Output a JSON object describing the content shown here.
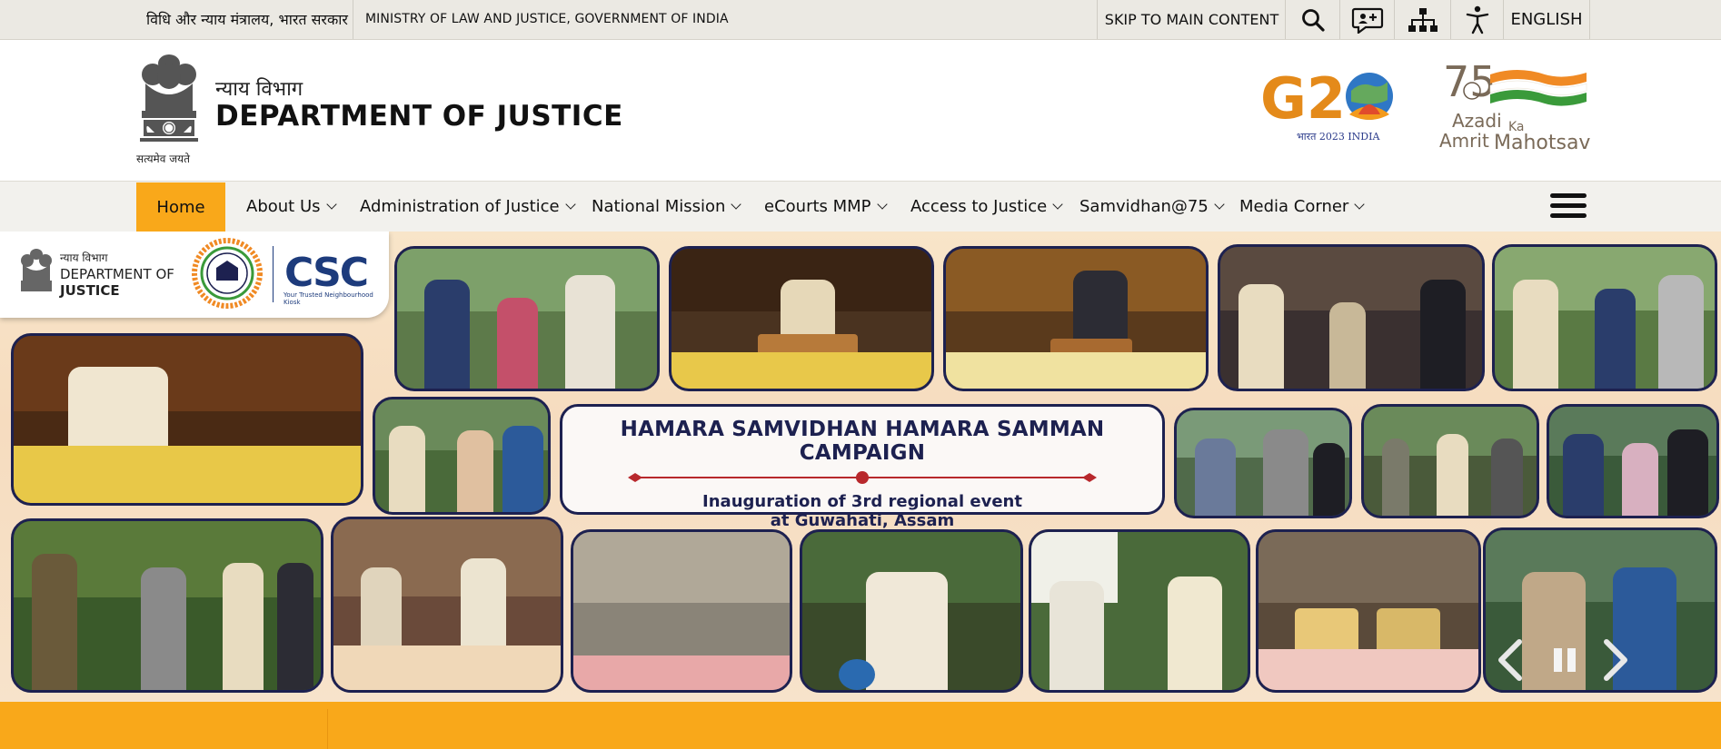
{
  "topbar": {
    "ministry_hindi": "विधि और न्याय मंत्रालय, भारत सरकार",
    "ministry_english": "MINISTRY OF LAW AND JUSTICE, GOVERNMENT OF INDIA",
    "skip_link": "SKIP TO MAIN CONTENT",
    "language": "ENGLISH",
    "icons": [
      "search-icon",
      "feedback-icon",
      "sitemap-icon",
      "accessibility-icon"
    ]
  },
  "header": {
    "dept_hindi": "न्याय विभाग",
    "dept_english": "DEPARTMENT OF JUSTICE",
    "motto": "सत्यमेव जयते",
    "g20_logo": {
      "text": "G20",
      "subtitle": "भारत 2023 INDIA"
    },
    "amrit_logo": {
      "number": "75",
      "line1": "Azadi",
      "ka": "Ka",
      "line2": "Amrit",
      "line3": "Mahotsav"
    }
  },
  "nav": {
    "home": "Home",
    "items": [
      {
        "label": "About Us"
      },
      {
        "label": "Administration of Justice"
      },
      {
        "label": "National Mission"
      },
      {
        "label": "eCourts MMP"
      },
      {
        "label": "Access to Justice"
      },
      {
        "label": "Samvidhan@75"
      },
      {
        "label": "Media Corner"
      }
    ]
  },
  "banner": {
    "logo_strip": {
      "hindi": "न्याय विभाग",
      "dept_of": "DEPARTMENT OF",
      "justice": "JUSTICE",
      "csc": "CSC",
      "csc_tagline": "Your Trusted Neighbourhood Kiosk"
    },
    "campaign_title": "HAMARA SAMVIDHAN HAMARA SAMMAN CAMPAIGN",
    "campaign_line1": "Inauguration of 3rd regional event",
    "campaign_line2": "at Guwahati, Assam",
    "controls": [
      "prev-arrow-icon",
      "pause-icon",
      "next-arrow-icon"
    ]
  },
  "colors": {
    "accent": "#f9a81a",
    "navy": "#1d2150",
    "topbar_bg": "#ebe9e3",
    "nav_bg": "#f2f1ed"
  }
}
